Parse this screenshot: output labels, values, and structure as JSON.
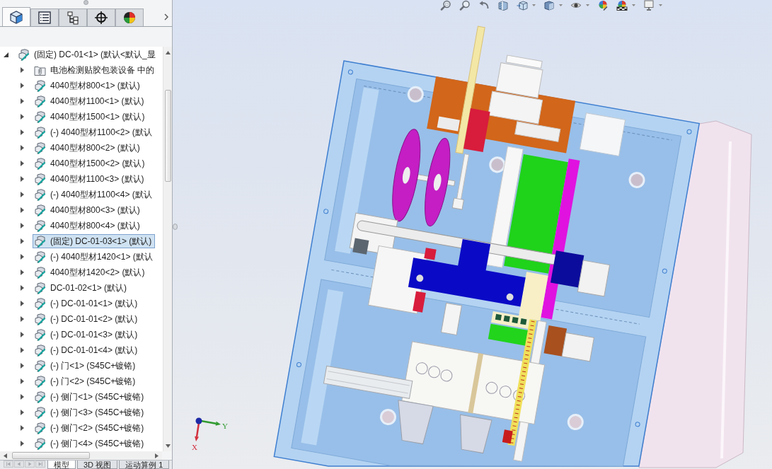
{
  "feature_manager": {
    "tabs": [
      {
        "selected": true
      },
      {
        "selected": false
      },
      {
        "selected": false
      },
      {
        "selected": false
      },
      {
        "selected": false
      }
    ],
    "tree": {
      "label": "(固定) DC-01<1> (默认<默认_显",
      "kind": "component",
      "expanded": true,
      "selected": false,
      "children": [
        {
          "label": "电池检测贴胶包装设备 中的",
          "kind": "folder",
          "expanded": false,
          "selected": false
        },
        {
          "label": "4040型材800<1> (默认)",
          "kind": "component",
          "expanded": false,
          "selected": false
        },
        {
          "label": "4040型材1100<1> (默认)",
          "kind": "component",
          "expanded": false,
          "selected": false
        },
        {
          "label": "4040型材1500<1> (默认)",
          "kind": "component",
          "expanded": false,
          "selected": false
        },
        {
          "label": "(-) 4040型材1100<2> (默认",
          "kind": "component",
          "expanded": false,
          "selected": false
        },
        {
          "label": "4040型材800<2> (默认)",
          "kind": "component",
          "expanded": false,
          "selected": false
        },
        {
          "label": "4040型材1500<2> (默认)",
          "kind": "component",
          "expanded": false,
          "selected": false
        },
        {
          "label": "4040型材1100<3> (默认)",
          "kind": "component",
          "expanded": false,
          "selected": false
        },
        {
          "label": "(-) 4040型材1100<4> (默认",
          "kind": "component",
          "expanded": false,
          "selected": false
        },
        {
          "label": "4040型材800<3> (默认)",
          "kind": "component",
          "expanded": false,
          "selected": false
        },
        {
          "label": "4040型材800<4> (默认)",
          "kind": "component",
          "expanded": false,
          "selected": false
        },
        {
          "label": "(固定) DC-01-03<1> (默认)",
          "kind": "component",
          "expanded": false,
          "selected": true
        },
        {
          "label": "(-) 4040型材1420<1> (默认",
          "kind": "component",
          "expanded": false,
          "selected": false
        },
        {
          "label": "4040型材1420<2> (默认)",
          "kind": "component",
          "expanded": false,
          "selected": false
        },
        {
          "label": "DC-01-02<1> (默认)",
          "kind": "component",
          "expanded": false,
          "selected": false
        },
        {
          "label": "(-) DC-01-01<1> (默认)",
          "kind": "component",
          "expanded": false,
          "selected": false
        },
        {
          "label": "(-) DC-01-01<2> (默认)",
          "kind": "component",
          "expanded": false,
          "selected": false
        },
        {
          "label": "(-) DC-01-01<3> (默认)",
          "kind": "component",
          "expanded": false,
          "selected": false
        },
        {
          "label": "(-) DC-01-01<4> (默认)",
          "kind": "component",
          "expanded": false,
          "selected": false
        },
        {
          "label": "(-) 门<1> (S45C+镀铬)",
          "kind": "component",
          "expanded": false,
          "selected": false
        },
        {
          "label": "(-) 门<2> (S45C+镀铬)",
          "kind": "component",
          "expanded": false,
          "selected": false
        },
        {
          "label": "(-) 侧门<1> (S45C+镀铬)",
          "kind": "component",
          "expanded": false,
          "selected": false
        },
        {
          "label": "(-) 侧门<3> (S45C+镀铬)",
          "kind": "component",
          "expanded": false,
          "selected": false
        },
        {
          "label": "(-) 侧门<2> (S45C+镀铬)",
          "kind": "component",
          "expanded": false,
          "selected": false
        },
        {
          "label": "(-) 侧门<4> (S45C+镀铬)",
          "kind": "component",
          "expanded": false,
          "selected": false
        }
      ]
    }
  },
  "bottom_tabs": [
    {
      "label": "模型",
      "selected": true
    },
    {
      "label": "3D 视图",
      "selected": false
    },
    {
      "label": "运动算例 1",
      "selected": false
    }
  ],
  "view_toolbar": [
    {
      "has_menu": false
    },
    {
      "has_menu": false
    },
    {
      "has_menu": false
    },
    {
      "has_menu": false
    },
    {
      "has_menu": true
    },
    {
      "has_menu": true
    },
    {
      "has_menu": true
    },
    {
      "has_menu": false
    },
    {
      "has_menu": true
    },
    {
      "has_menu": true
    }
  ],
  "triad": {
    "axes": [
      {
        "label": "Y",
        "color": "#2f9a2f"
      },
      {
        "label": "X",
        "color": "#d2303e"
      }
    ]
  }
}
